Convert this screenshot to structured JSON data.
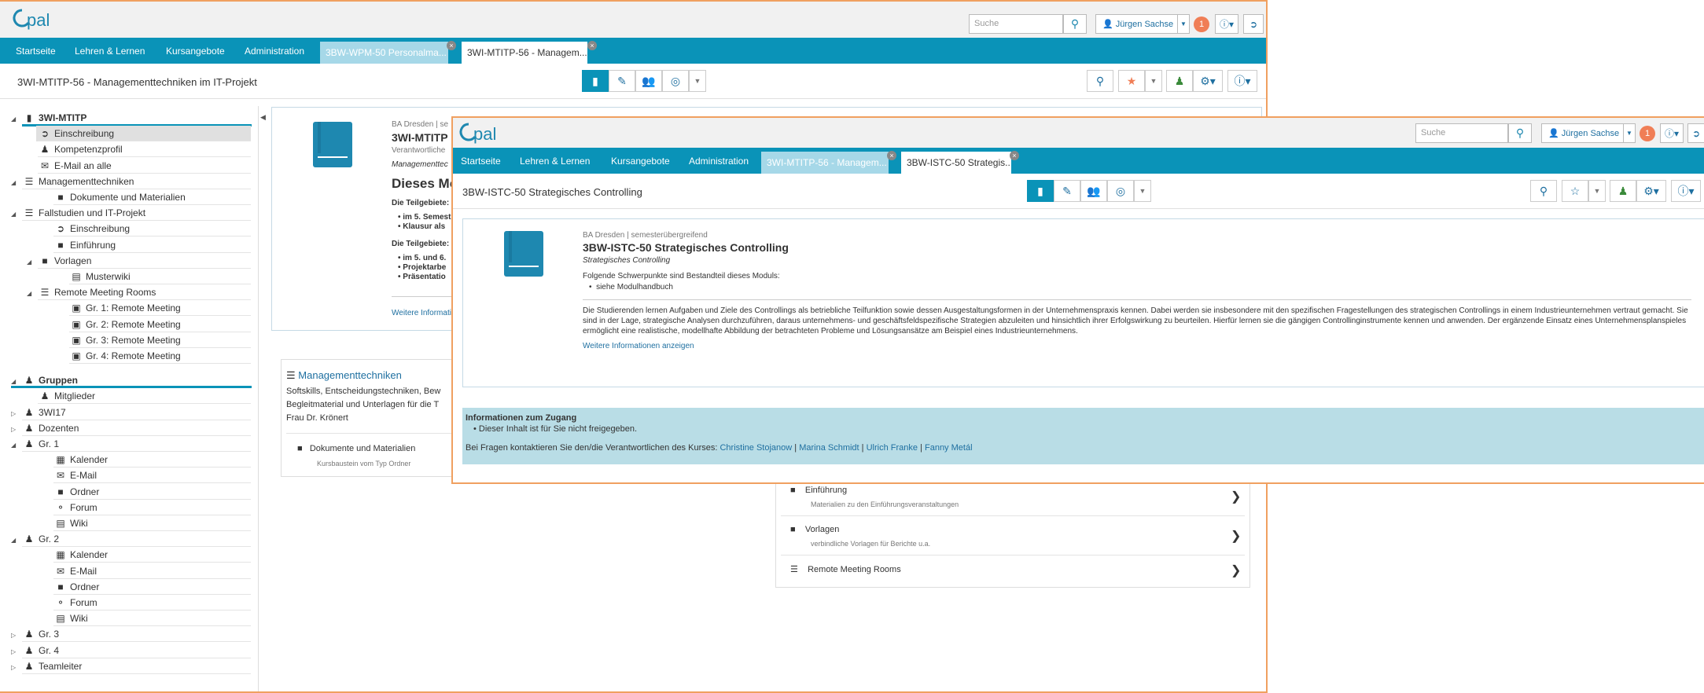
{
  "colors": {
    "accent": "#0a93b8",
    "window_border": "#f0a060",
    "badge": "#f07e56",
    "link": "#1e6fa0"
  },
  "window_back": {
    "header": {
      "search_placeholder": "Suche",
      "user": "Jürgen Sachse",
      "notif_count": "1",
      "help": "?"
    },
    "nav": {
      "items": [
        "Startseite",
        "Lehren & Lernen",
        "Kursangebote",
        "Administration"
      ],
      "tabs": [
        {
          "label": "3BW-WPM-50 Personalma...",
          "state": "inactive"
        },
        {
          "label": "3WI-MTITP-56 - Managem...",
          "state": "active"
        }
      ]
    },
    "course_title": "3WI-MTITP-56 - Managementtechniken im IT-Projekt",
    "tree": [
      {
        "label": "3WI-MTITP",
        "level": 0,
        "icon": "book-icon",
        "exp": "open",
        "bold": true
      },
      {
        "label": "Einschreibung",
        "level": 1,
        "icon": "enrollment-icon",
        "selected": true
      },
      {
        "label": "Kompetenzprofil",
        "level": 1,
        "icon": "user-icon"
      },
      {
        "label": "E-Mail an alle",
        "level": 1,
        "icon": "mail-icon"
      },
      {
        "label": "Managementtechniken",
        "level": 0,
        "icon": "stack-icon",
        "exp": "open"
      },
      {
        "label": "Dokumente und Materialien",
        "level": 2,
        "icon": "folder-icon"
      },
      {
        "label": "Fallstudien und IT-Projekt",
        "level": 0,
        "icon": "stack-icon",
        "exp": "open"
      },
      {
        "label": "Einschreibung",
        "level": 2,
        "icon": "enrollment-icon"
      },
      {
        "label": "Einführung",
        "level": 2,
        "icon": "folder-icon"
      },
      {
        "label": "Vorlagen",
        "level": 1,
        "icon": "folder-icon",
        "exp": "open"
      },
      {
        "label": "Musterwiki",
        "level": 3,
        "icon": "wiki-icon"
      },
      {
        "label": "Remote Meeting Rooms",
        "level": 1,
        "icon": "stack-icon",
        "exp": "open"
      },
      {
        "label": "Gr. 1: Remote Meeting",
        "level": 3,
        "icon": "monitor-icon"
      },
      {
        "label": "Gr. 2: Remote Meeting",
        "level": 3,
        "icon": "monitor-icon"
      },
      {
        "label": "Gr. 3: Remote Meeting",
        "level": 3,
        "icon": "monitor-icon"
      },
      {
        "label": "Gr. 4: Remote Meeting",
        "level": 3,
        "icon": "monitor-icon"
      }
    ],
    "groups_title": "Gruppen",
    "groups": [
      {
        "label": "Mitglieder",
        "level": 1,
        "icon": "user-icon"
      },
      {
        "label": "3WI17",
        "level": 0,
        "icon": "group-icon",
        "exp": "closed"
      },
      {
        "label": "Dozenten",
        "level": 0,
        "icon": "group-icon",
        "exp": "closed"
      },
      {
        "label": "Gr. 1",
        "level": 0,
        "icon": "group-icon",
        "exp": "open"
      },
      {
        "label": "Kalender",
        "level": 2,
        "icon": "calendar-icon"
      },
      {
        "label": "E-Mail",
        "level": 2,
        "icon": "mail-icon"
      },
      {
        "label": "Ordner",
        "level": 2,
        "icon": "folder-icon"
      },
      {
        "label": "Forum",
        "level": 2,
        "icon": "forum-icon"
      },
      {
        "label": "Wiki",
        "level": 2,
        "icon": "wiki-icon"
      },
      {
        "label": "Gr. 2",
        "level": 0,
        "icon": "group-icon",
        "exp": "open"
      },
      {
        "label": "Kalender",
        "level": 2,
        "icon": "calendar-icon"
      },
      {
        "label": "E-Mail",
        "level": 2,
        "icon": "mail-icon"
      },
      {
        "label": "Ordner",
        "level": 2,
        "icon": "folder-icon"
      },
      {
        "label": "Forum",
        "level": 2,
        "icon": "forum-icon"
      },
      {
        "label": "Wiki",
        "level": 2,
        "icon": "wiki-icon"
      },
      {
        "label": "Gr. 3",
        "level": 0,
        "icon": "group-icon",
        "exp": "closed"
      },
      {
        "label": "Gr. 4",
        "level": 0,
        "icon": "group-icon",
        "exp": "closed"
      },
      {
        "label": "Teamleiter",
        "level": 0,
        "icon": "group-icon",
        "exp": "closed"
      }
    ],
    "info": {
      "org": "BA Dresden | se",
      "code": "3WI-MTITP",
      "resp": "Verantwortliche",
      "subtitle": "Managementtec",
      "heading": "Dieses Mo",
      "p1": "Die Teilgebiete: S",
      "b1": [
        "im 5. Semest",
        "Klausur als"
      ],
      "p2": "Die Teilgebiete: I",
      "b2": [
        "im 5. und 6.",
        "Projektarbe",
        "Präsentatio"
      ],
      "more": "Weitere Informati"
    },
    "mgmt": {
      "title": "Managementtechniken",
      "lines": [
        "Softskills, Entscheidungstechniken, Bew",
        "Begleitmaterial und Unterlagen für die T",
        "Frau Dr. Krönert"
      ],
      "doc": "Dokumente und Materialien",
      "doc_sub": "Kursbaustein vom Typ Ordner"
    },
    "fall": [
      {
        "label": "Einführung",
        "sub": "Materialien zu den Einführungsveranstaltungen",
        "icon": "folder-icon"
      },
      {
        "label": "Vorlagen",
        "sub": "verbindliche Vorlagen für Berichte u.a.",
        "icon": "folder-icon"
      },
      {
        "label": "Remote Meeting Rooms",
        "sub": "",
        "icon": "stack-icon"
      }
    ]
  },
  "window_front": {
    "header": {
      "search_placeholder": "Suche",
      "user": "Jürgen Sachse",
      "notif_count": "1",
      "help": "?"
    },
    "nav": {
      "items": [
        "Startseite",
        "Lehren & Lernen",
        "Kursangebote",
        "Administration"
      ],
      "tabs": [
        {
          "label": "3WI-MTITP-56 - Managem...",
          "state": "inactive"
        },
        {
          "label": "3BW-ISTC-50 Strategis...",
          "state": "active"
        }
      ]
    },
    "course_title": "3BW-ISTC-50 Strategisches Controlling",
    "info": {
      "org": "BA Dresden | semesterübergreifend",
      "code": "3BW-ISTC-50 Strategisches Controlling",
      "subtitle": "Strategisches Controlling",
      "intro": "Folgende Schwerpunkte sind Bestandteil dieses Moduls:",
      "bullet": "siehe Modulhandbuch",
      "desc": "Die Studierenden lernen Aufgaben und Ziele des Controllings als betriebliche Teilfunktion sowie dessen Ausgestaltungsformen in der Unternehmenspraxis kennen. Dabei werden sie insbesondere mit den spezifischen Fragestellungen des strategischen Controllings in einem Industrieunternehmen vertraut gemacht. Sie sind in der Lage, strategische Analysen durchzuführen, daraus unternehmens- und geschäftsfeldspezifische Strategien abzuleiten und hinsichtlich ihrer Erfolgswirkung zu beurteilen. Hierfür lernen sie die gängigen Controllinginstrumente kennen und anwenden. Der ergänzende Einsatz eines Unternehmensplanspieles ermöglicht eine realistische, modellhafte Abbildung der betrachteten Probleme und Lösungsansätze am Beispiel eines Industrieunternehmens.",
      "more": "Weitere Informationen anzeigen"
    },
    "access": {
      "title": "Informationen zum Zugang",
      "bullet": "Dieser Inhalt ist für Sie nicht freigegeben.",
      "contact_prefix": "Bei Fragen kontaktieren Sie den/die Verantwortlichen des Kurses:",
      "contacts": [
        "Christine Stojanow",
        "Marina Schmidt",
        "Ulrich Franke",
        "Fanny Metál"
      ]
    }
  }
}
